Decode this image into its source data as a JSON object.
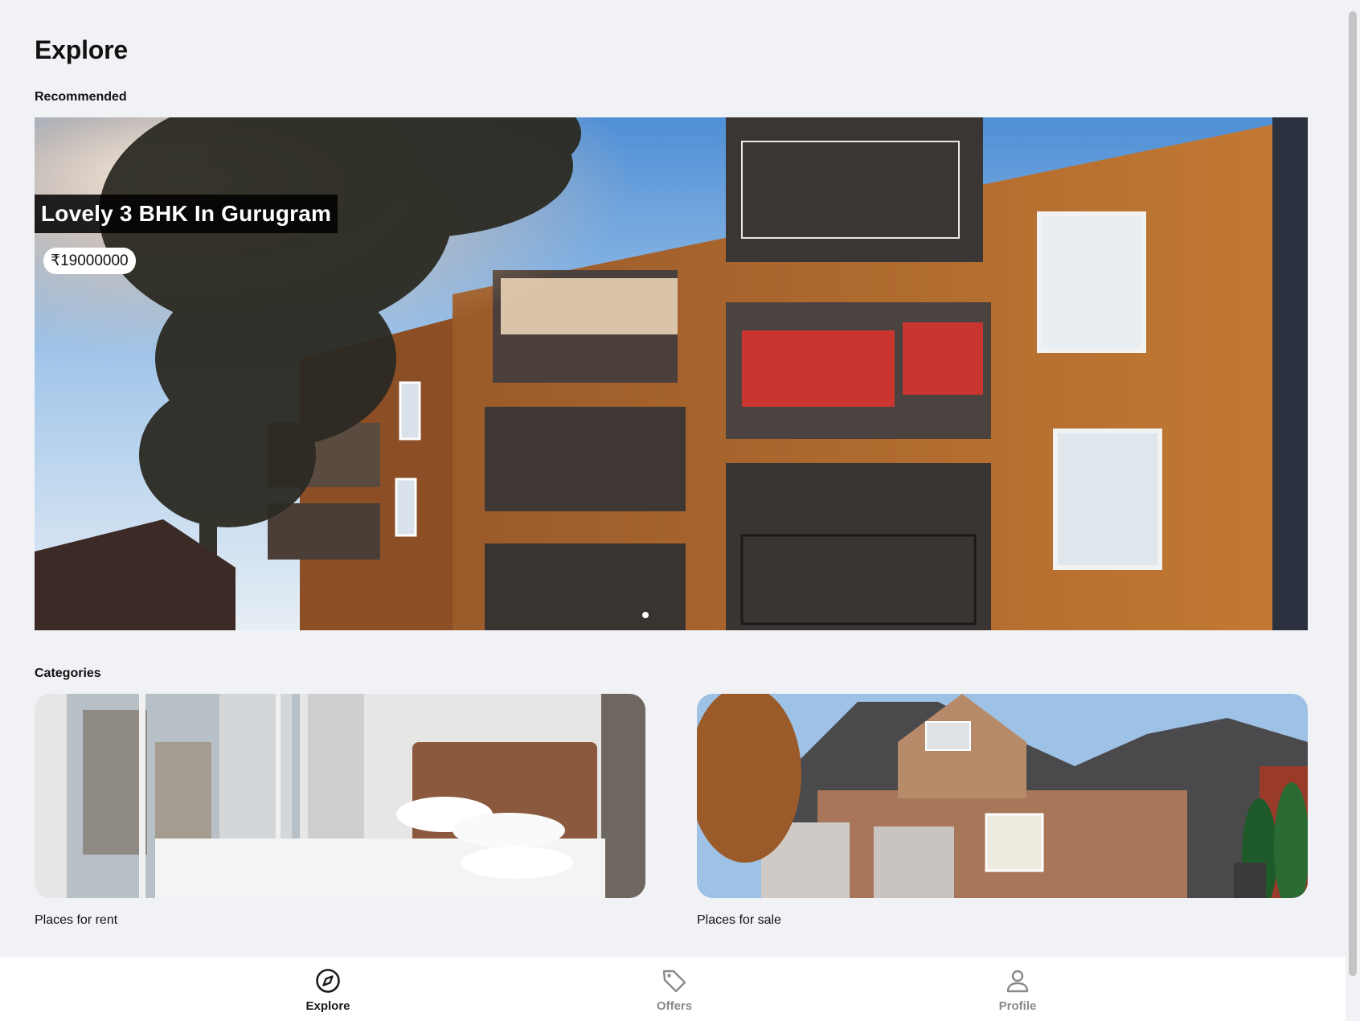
{
  "page": {
    "title": "Explore"
  },
  "recommended": {
    "label": "Recommended",
    "listing": {
      "title": "Lovely 3 BHK In Gurugram",
      "price": "₹19000000"
    }
  },
  "categories": {
    "label": "Categories",
    "items": [
      {
        "label": "Places for rent"
      },
      {
        "label": "Places for sale"
      }
    ]
  },
  "bottom_nav": {
    "items": [
      {
        "label": "Explore",
        "icon": "compass-icon",
        "active": true
      },
      {
        "label": "Offers",
        "icon": "tag-icon",
        "active": false
      },
      {
        "label": "Profile",
        "icon": "person-icon",
        "active": false
      }
    ]
  },
  "colors": {
    "background": "#f1f2f5",
    "nav_active": "#1b1b1b",
    "nav_inactive": "#8a8a8a",
    "title_overlay": "#000000"
  }
}
